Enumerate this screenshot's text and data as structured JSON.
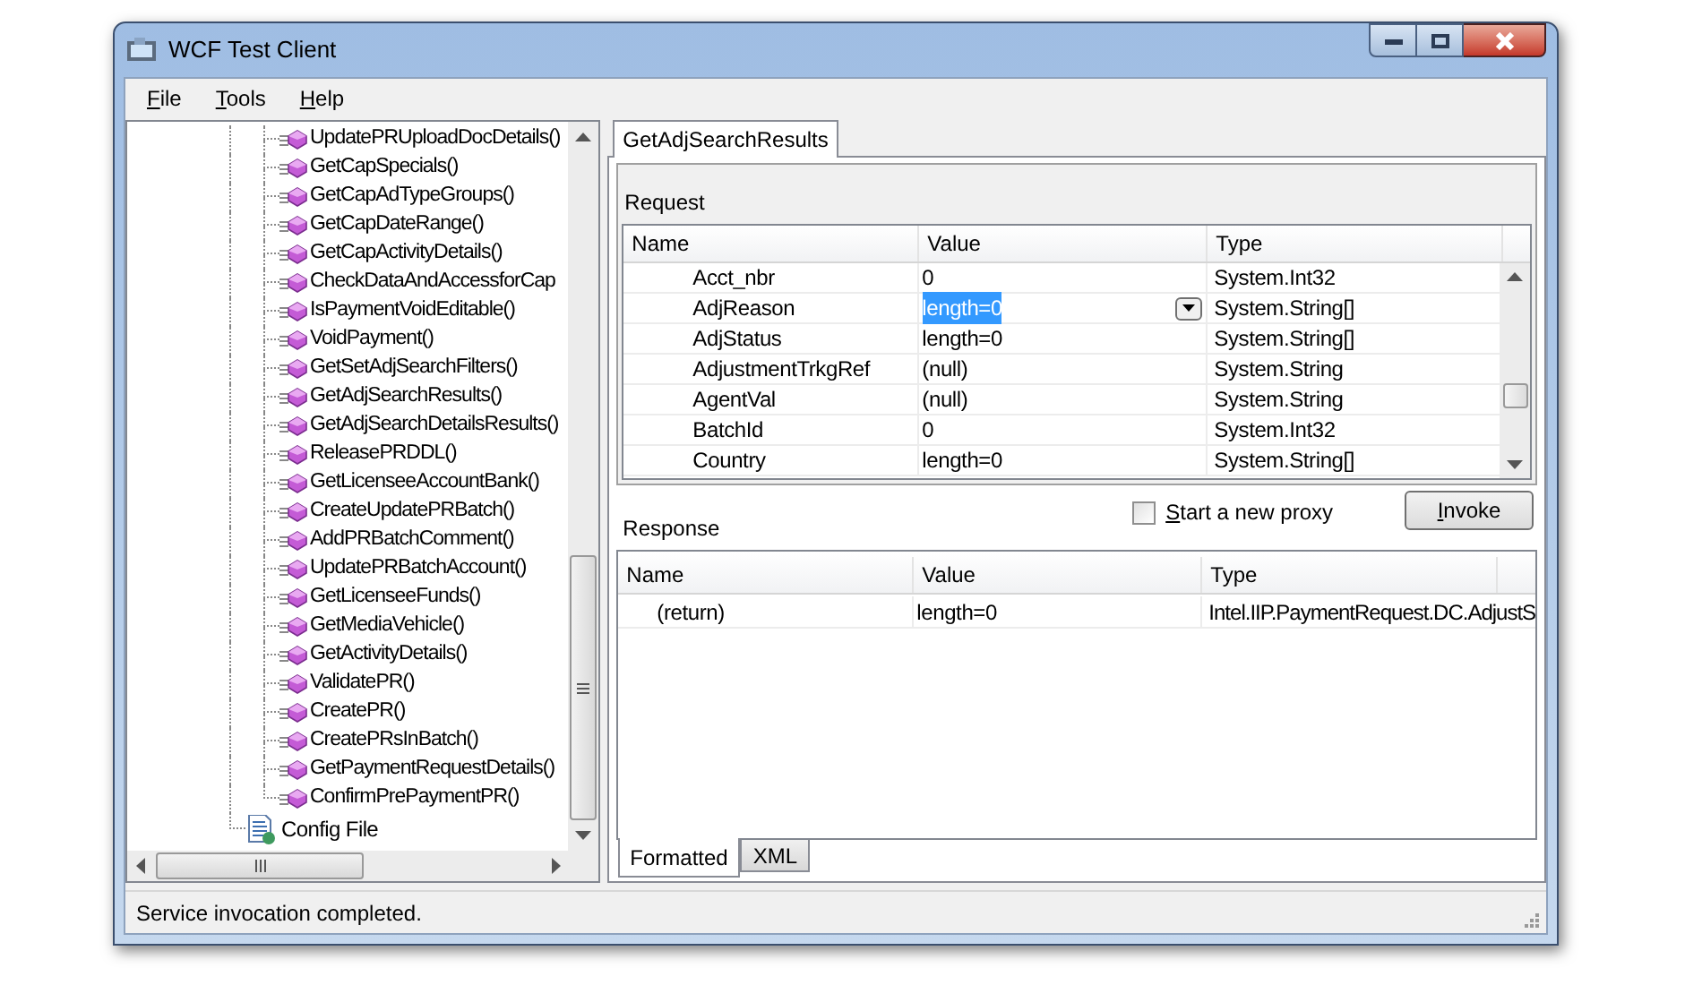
{
  "window": {
    "title": "WCF Test Client"
  },
  "menu": [
    "File",
    "Tools",
    "Help"
  ],
  "tree": {
    "items": [
      {
        "label": "UpdatePRUploadDocDetails()",
        "kind": "method"
      },
      {
        "label": "GetCapSpecials()",
        "kind": "method"
      },
      {
        "label": "GetCapAdTypeGroups()",
        "kind": "method"
      },
      {
        "label": "GetCapDateRange()",
        "kind": "method"
      },
      {
        "label": "GetCapActivityDetails()",
        "kind": "method"
      },
      {
        "label": "CheckDataAndAccessforCap",
        "kind": "method"
      },
      {
        "label": "IsPaymentVoidEditable()",
        "kind": "method"
      },
      {
        "label": "VoidPayment()",
        "kind": "method"
      },
      {
        "label": "GetSetAdjSearchFilters()",
        "kind": "method"
      },
      {
        "label": "GetAdjSearchResults()",
        "kind": "method"
      },
      {
        "label": "GetAdjSearchDetailsResults()",
        "kind": "method"
      },
      {
        "label": "ReleasePRDDL()",
        "kind": "method"
      },
      {
        "label": "GetLicenseeAccountBank()",
        "kind": "method"
      },
      {
        "label": "CreateUpdatePRBatch()",
        "kind": "method"
      },
      {
        "label": "AddPRBatchComment()",
        "kind": "method"
      },
      {
        "label": "UpdatePRBatchAccount()",
        "kind": "method"
      },
      {
        "label": "GetLicenseeFunds()",
        "kind": "method"
      },
      {
        "label": "GetMediaVehicle()",
        "kind": "method"
      },
      {
        "label": "GetActivityDetails()",
        "kind": "method"
      },
      {
        "label": "ValidatePR()",
        "kind": "method"
      },
      {
        "label": "CreatePR()",
        "kind": "method"
      },
      {
        "label": "CreatePRsInBatch()",
        "kind": "method"
      },
      {
        "label": "GetPaymentRequestDetails()",
        "kind": "method"
      },
      {
        "label": "ConfirmPrePaymentPR()",
        "kind": "method"
      },
      {
        "label": "Config File",
        "kind": "config"
      }
    ]
  },
  "tabs": [
    {
      "label": "GetAdjSearchResults",
      "selected": true
    }
  ],
  "request": {
    "label": "Request",
    "columns": [
      "Name",
      "Value",
      "Type"
    ],
    "rows": [
      {
        "name": "Acct_nbr",
        "value": "0",
        "type": "System.Int32",
        "selected": false
      },
      {
        "name": "AdjReason",
        "value": "length=0",
        "type": "System.String[]",
        "selected": true
      },
      {
        "name": "AdjStatus",
        "value": "length=0",
        "type": "System.String[]",
        "selected": false
      },
      {
        "name": "AdjustmentTrkgRef",
        "value": "(null)",
        "type": "System.String",
        "selected": false
      },
      {
        "name": "AgentVal",
        "value": "(null)",
        "type": "System.String",
        "selected": false
      },
      {
        "name": "BatchId",
        "value": "0",
        "type": "System.Int32",
        "selected": false
      },
      {
        "name": "Country",
        "value": "length=0",
        "type": "System.String[]",
        "selected": false
      }
    ]
  },
  "proxy_checkbox": {
    "label": "Start a new proxy",
    "checked": false
  },
  "invoke_button": "Invoke",
  "response": {
    "label": "Response",
    "columns": [
      "Name",
      "Value",
      "Type"
    ],
    "rows": [
      {
        "name": "(return)",
        "value": "length=0",
        "type": "Intel.IIP.PaymentRequest.DC.AdjustS"
      }
    ]
  },
  "view_tabs": [
    {
      "label": "Formatted",
      "selected": true
    },
    {
      "label": "XML",
      "selected": false
    }
  ],
  "status_bar": "Service invocation completed."
}
